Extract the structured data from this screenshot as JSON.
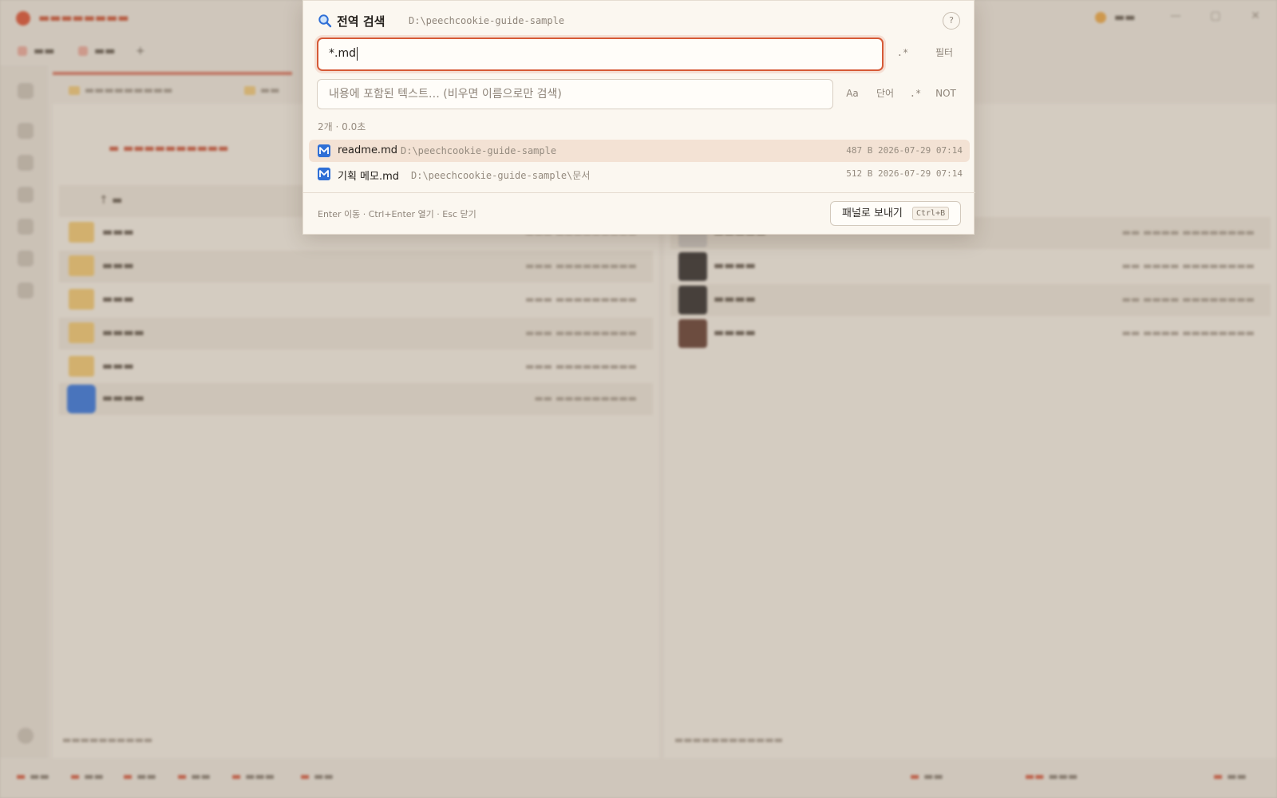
{
  "colors": {
    "accent": "#d65a37",
    "selected_row": "#f3e2d4",
    "modal_bg": "#fbf7f0",
    "md_icon": "#2f6fd6"
  },
  "search_modal": {
    "title": "전역 검색",
    "root_path": "D:\\peechcookie-guide-sample",
    "help_label": "?",
    "name_query": "*.md",
    "regex_toggle": ".*",
    "filter_button": "필터",
    "content_placeholder": "내용에 포함된 텍스트… (비우면 이름으로만 검색)",
    "content_options": {
      "case": "Aa",
      "word": "단어",
      "regex": ".*",
      "not": "NOT"
    },
    "result_summary": "2개 · 0.0초",
    "results": [
      {
        "icon": "markdown-icon",
        "name": "readme.md",
        "path": "D:\\peechcookie-guide-sample",
        "meta": "487 B 2026-07-29 07:14",
        "selected": true
      },
      {
        "icon": "markdown-icon",
        "name": "기획 메모.md",
        "path": "D:\\peechcookie-guide-sample\\문서",
        "meta": "512 B 2026-07-29 07:14",
        "selected": false
      }
    ],
    "footer_hints": "Enter 이동 · Ctrl+Enter 열기 · Esc 닫기",
    "send_button": {
      "label": "패널로 보내기",
      "shortcut": "Ctrl+B"
    }
  }
}
